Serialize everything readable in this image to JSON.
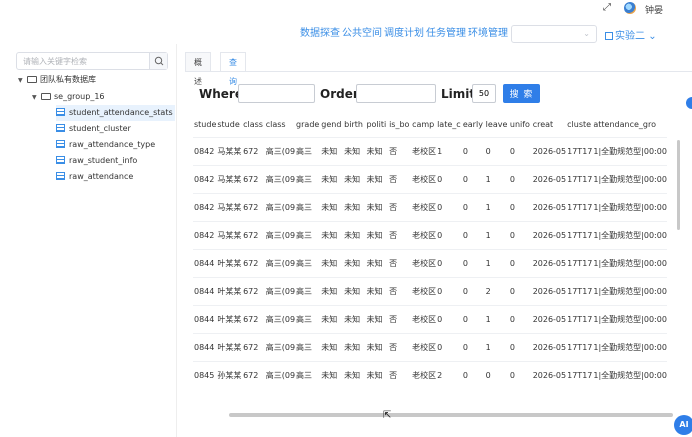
{
  "header": {
    "user_name": "钟晏",
    "nav": [
      "数据探查",
      "公共空间",
      "调度计划",
      "任务管理",
      "环境管理"
    ],
    "project_select_value": "",
    "experiment_label": "实验二"
  },
  "sidebar": {
    "search_placeholder": "请输入关键字检索",
    "root_label": "团队私有数据库",
    "group_label": "se_group_16",
    "tables": [
      "student_attendance_stats",
      "student_cluster",
      "raw_attendance_type",
      "raw_student_info",
      "raw_attendance"
    ]
  },
  "tabs": [
    "概述",
    "查询"
  ],
  "query": {
    "where_label": "Where",
    "order_label": "Order",
    "limit_label": "Limit",
    "limit_value": "50",
    "search_button": "搜 索"
  },
  "table": {
    "columns": [
      "stude",
      "stude",
      "class",
      "class",
      "grade",
      "gend",
      "birth",
      "politi",
      "is_bo",
      "camp",
      "late_c",
      "early",
      "leave",
      "unifo",
      "creat",
      "cluste",
      "attendance_gro"
    ],
    "rows": [
      [
        "0842",
        "马某某",
        "672",
        "高三(09",
        "高三",
        "未知",
        "未知",
        "未知",
        "否",
        "老校区",
        "1",
        "0",
        "0",
        "0",
        "2026-05",
        "17T17",
        "1|全勤规范型|00:00"
      ],
      [
        "0842",
        "马某某",
        "672",
        "高三(09",
        "高三",
        "未知",
        "未知",
        "未知",
        "否",
        "老校区",
        "0",
        "0",
        "1",
        "0",
        "2026-05",
        "17T17",
        "1|全勤规范型|00:00"
      ],
      [
        "0842",
        "马某某",
        "672",
        "高三(09",
        "高三",
        "未知",
        "未知",
        "未知",
        "否",
        "老校区",
        "0",
        "0",
        "1",
        "0",
        "2026-05",
        "17T17",
        "1|全勤规范型|00:00"
      ],
      [
        "0842",
        "马某某",
        "672",
        "高三(09",
        "高三",
        "未知",
        "未知",
        "未知",
        "否",
        "老校区",
        "0",
        "0",
        "1",
        "0",
        "2026-05",
        "17T17",
        "1|全勤规范型|00:00"
      ],
      [
        "0844",
        "叶某某",
        "672",
        "高三(09",
        "高三",
        "未知",
        "未知",
        "未知",
        "否",
        "老校区",
        "0",
        "0",
        "1",
        "0",
        "2026-05",
        "17T17",
        "1|全勤规范型|00:00"
      ],
      [
        "0844",
        "叶某某",
        "672",
        "高三(09",
        "高三",
        "未知",
        "未知",
        "未知",
        "否",
        "老校区",
        "0",
        "0",
        "2",
        "0",
        "2026-05",
        "17T17",
        "1|全勤规范型|00:00"
      ],
      [
        "0844",
        "叶某某",
        "672",
        "高三(09",
        "高三",
        "未知",
        "未知",
        "未知",
        "否",
        "老校区",
        "0",
        "0",
        "1",
        "0",
        "2026-05",
        "17T17",
        "1|全勤规范型|00:00"
      ],
      [
        "0844",
        "叶某某",
        "672",
        "高三(09",
        "高三",
        "未知",
        "未知",
        "未知",
        "否",
        "老校区",
        "0",
        "0",
        "1",
        "0",
        "2026-05",
        "17T17",
        "1|全勤规范型|00:00"
      ],
      [
        "0845",
        "孙某某",
        "672",
        "高三(09",
        "高三",
        "未知",
        "未知",
        "未知",
        "否",
        "老校区",
        "2",
        "0",
        "0",
        "0",
        "2026-05",
        "17T17",
        "1|全勤规范型|00:00"
      ]
    ]
  },
  "ai_button": "AI",
  "colors": {
    "accent": "#2f7ee8",
    "link": "#3a8ee6"
  }
}
